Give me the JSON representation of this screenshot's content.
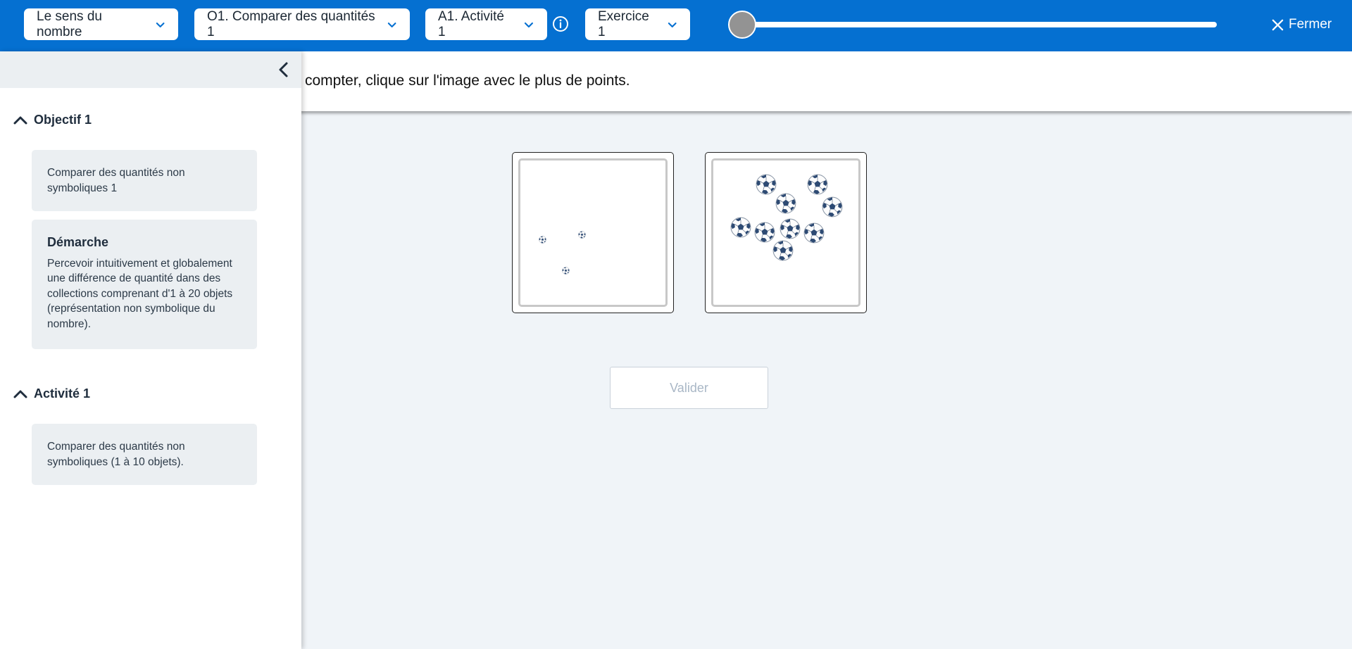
{
  "header": {
    "dropdowns": [
      {
        "label": "Le sens du nombre"
      },
      {
        "label": "O1. Comparer des quantités 1"
      },
      {
        "label": "A1. Activité 1"
      },
      {
        "label": "Exercice 1"
      }
    ],
    "progress": 0,
    "close_label": "Fermer"
  },
  "instruction": "compter, clique sur l'image avec le plus de points.",
  "sidebar": {
    "objective": {
      "heading": "Objectif 1",
      "card_text": "Comparer des quantités non symboliques 1",
      "approach_title": "Démarche",
      "approach_text": "Percevoir intuitivement et globalement une différence de quantité dans des collections comprenant d'1 à 20 objets (représentation non symbolique du nombre)."
    },
    "activity": {
      "heading": "Activité 1",
      "card_text": "Comparer des quantités non symboliques (1 à 10 objets)."
    }
  },
  "answers": [
    {
      "ball_count": 3
    },
    {
      "ball_count": 10
    }
  ],
  "validate_label": "Valider",
  "colors": {
    "topbar": "#0570d1",
    "sidebar_card": "#ebeff2",
    "canvas": "#f0f4f8",
    "ball_patch": "#2d4a73"
  },
  "icons": [
    "chevron-down-icon",
    "info-icon",
    "close-icon",
    "chevron-left-icon",
    "chevron-up-icon",
    "soccer-ball-icon"
  ]
}
